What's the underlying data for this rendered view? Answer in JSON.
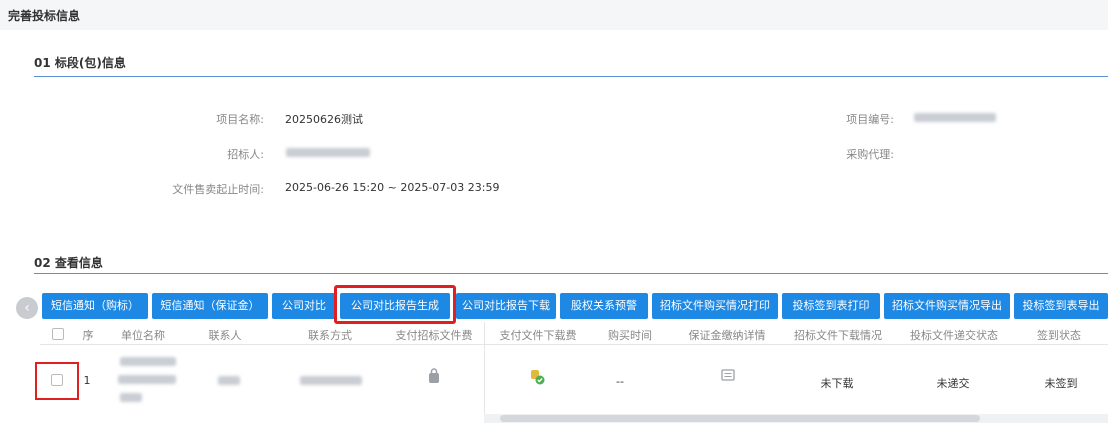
{
  "page": {
    "title": "完善投标信息"
  },
  "section1": {
    "title": "01 标段(包)信息",
    "fields": {
      "project_name_label": "项目名称:",
      "project_name_value": "20250626测试",
      "project_no_label": "项目编号:",
      "tenderer_label": "招标人:",
      "agency_label": "采购代理:",
      "sale_time_label": "文件售卖起止时间:",
      "sale_time_value": "2025-06-26 15:20 ~ 2025-07-03 23:59"
    }
  },
  "section2": {
    "title": "02 查看信息",
    "buttons": [
      "短信通知（购标）",
      "短信通知（保证金）",
      "公司对比",
      "公司对比报告生成",
      "公司对比报告下载",
      "股权关系预警",
      "招标文件购买情况打印",
      "投标签到表打印",
      "招标文件购买情况导出",
      "投标签到表导出"
    ],
    "columns": [
      "序",
      "单位名称",
      "联系人",
      "联系方式",
      "支付招标文件费",
      "支付文件下载费",
      "购买时间",
      "保证金缴纳详情",
      "招标文件下载情况",
      "投标文件递交状态",
      "签到状态"
    ],
    "rows": [
      {
        "index": "1",
        "purchase_time": "--",
        "download_status": "未下载",
        "submit_status": "未递交",
        "signin_status": "未签到"
      }
    ]
  },
  "icons": {
    "nav_prev": "chevron-left-icon",
    "fee_paid": "bag-icon",
    "download_fee": "coin-check-icon",
    "deposit": "document-icon"
  },
  "colors": {
    "primary": "#1e88e5",
    "highlight": "#e02020",
    "section_line": "#5b8fd6"
  }
}
